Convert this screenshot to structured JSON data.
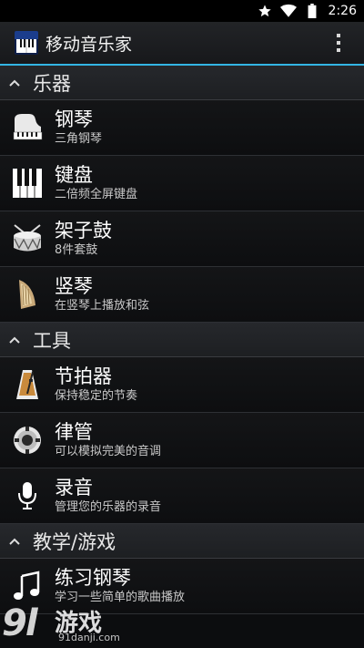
{
  "status_bar": {
    "time": "2:26",
    "icons": [
      "star-icon",
      "wifi-icon",
      "battery-icon"
    ]
  },
  "action_bar": {
    "title": "移动音乐家",
    "icon": "piano-app-icon",
    "accent": "#33b5e5"
  },
  "sections": [
    {
      "label": "乐器",
      "items": [
        {
          "title": "钢琴",
          "subtitle": "三角钢琴",
          "icon": "grand-piano-icon"
        },
        {
          "title": "键盘",
          "subtitle": "二倍频全屏键盘",
          "icon": "keyboard-icon"
        },
        {
          "title": "架子鼓",
          "subtitle": "8件套鼓",
          "icon": "drum-icon"
        },
        {
          "title": "竖琴",
          "subtitle": "在竖琴上播放和弦",
          "icon": "harp-icon"
        }
      ]
    },
    {
      "label": "工具",
      "items": [
        {
          "title": "节拍器",
          "subtitle": "保持稳定的节奏",
          "icon": "metronome-icon"
        },
        {
          "title": "律管",
          "subtitle": "可以模拟完美的音调",
          "icon": "pitch-pipe-icon"
        },
        {
          "title": "录音",
          "subtitle": "管理您的乐器的录音",
          "icon": "microphone-icon"
        }
      ]
    },
    {
      "label": "教学/游戏",
      "items": [
        {
          "title": "练习钢琴",
          "subtitle": "学习一些简单的歌曲播放",
          "icon": "music-note-icon"
        }
      ]
    }
  ],
  "watermark": {
    "logo": "9l",
    "text": "游戏",
    "url": "91danji.com"
  }
}
